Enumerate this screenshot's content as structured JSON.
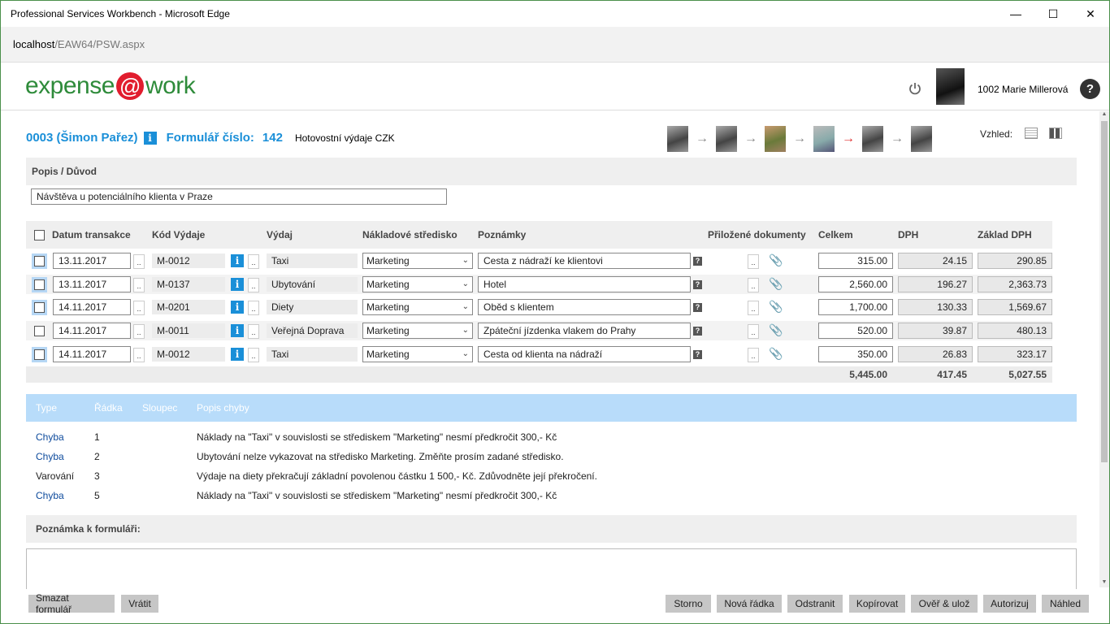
{
  "window": {
    "title": "Professional Services Workbench - Microsoft Edge",
    "url_host": "localhost",
    "url_path": "/EAW64/PSW.aspx"
  },
  "app": {
    "logo_left": "expense",
    "logo_at": "@",
    "logo_right": "work",
    "user": "1002 Marie Millerová",
    "help": "?"
  },
  "form": {
    "employee": "0003 (Šimon Pařez)",
    "form_number_label": "Formulář číslo:",
    "form_number": "142",
    "form_type": "Hotovostní výdaje CZK",
    "view_label": "Vzhled:",
    "description_label": "Popis / Důvod",
    "description_value": "Návštěva u potenciálního klienta v Praze"
  },
  "table": {
    "headers": {
      "date": "Datum transakce",
      "code": "Kód Výdaje",
      "expense": "Výdaj",
      "cost_center": "Nákladové středisko",
      "notes": "Poznámky",
      "attachments": "Přiložené dokumenty",
      "total": "Celkem",
      "vat": "DPH",
      "vat_base": "Základ DPH"
    },
    "rows": [
      {
        "date": "13.11.2017",
        "code": "M-0012",
        "expense": "Taxi",
        "cost_center": "Marketing",
        "note": "Cesta z nádraží ke klientovi",
        "total": "315.00",
        "vat": "24.15",
        "base": "290.85"
      },
      {
        "date": "13.11.2017",
        "code": "M-0137",
        "expense": "Ubytování",
        "cost_center": "Marketing",
        "note": "Hotel",
        "total": "2,560.00",
        "vat": "196.27",
        "base": "2,363.73"
      },
      {
        "date": "14.11.2017",
        "code": "M-0201",
        "expense": "Diety",
        "cost_center": "Marketing",
        "note": "Oběd s klientem",
        "total": "1,700.00",
        "vat": "130.33",
        "base": "1,569.67"
      },
      {
        "date": "14.11.2017",
        "code": "M-0011",
        "expense": "Veřejná Doprava",
        "cost_center": "Marketing",
        "note": "Zpáteční jízdenka vlakem do Prahy",
        "total": "520.00",
        "vat": "39.87",
        "base": "480.13"
      },
      {
        "date": "14.11.2017",
        "code": "M-0012",
        "expense": "Taxi",
        "cost_center": "Marketing",
        "note": "Cesta od klienta na nádraží",
        "total": "350.00",
        "vat": "26.83",
        "base": "323.17"
      }
    ],
    "totals": {
      "total": "5,445.00",
      "vat": "417.45",
      "base": "5,027.55"
    }
  },
  "errors": {
    "headers": {
      "type": "Type",
      "row": "Řádka",
      "column": "Sloupec",
      "desc": "Popis chyby"
    },
    "rows": [
      {
        "type": "Chyba",
        "row": "1",
        "desc": "Náklady na \"Taxi\" v souvislosti se střediskem \"Marketing\" nesmí předkročit 300,- Kč"
      },
      {
        "type": "Chyba",
        "row": "2",
        "desc": "Ubytování nelze vykazovat na středisko Marketing. Změňte prosím zadané středisko."
      },
      {
        "type": "Varování",
        "row": "3",
        "desc": "Výdaje na diety překračují základní povolenou částku 1 500,- Kč. Zdůvodněte její překročení."
      },
      {
        "type": "Chyba",
        "row": "5",
        "desc": "Náklady na \"Taxi\" v souvislosti se střediskem \"Marketing\" nesmí předkročit 300,- Kč"
      }
    ]
  },
  "note_label": "Poznámka k formuláři:",
  "buttons": {
    "delete_form": "Smazat formulář",
    "return": "Vrátit",
    "cancel": "Storno",
    "new_row": "Nová řádka",
    "remove": "Odstranit",
    "copy": "Kopírovat",
    "verify_save": "Ověř & ulož",
    "authorize": "Autorizuj",
    "preview": "Náhled"
  },
  "colors": {
    "accent": "#1a8fd8",
    "logo": "#2e8b3a",
    "logo_at": "#e11d2e",
    "error_header": "#b8dcfa"
  }
}
